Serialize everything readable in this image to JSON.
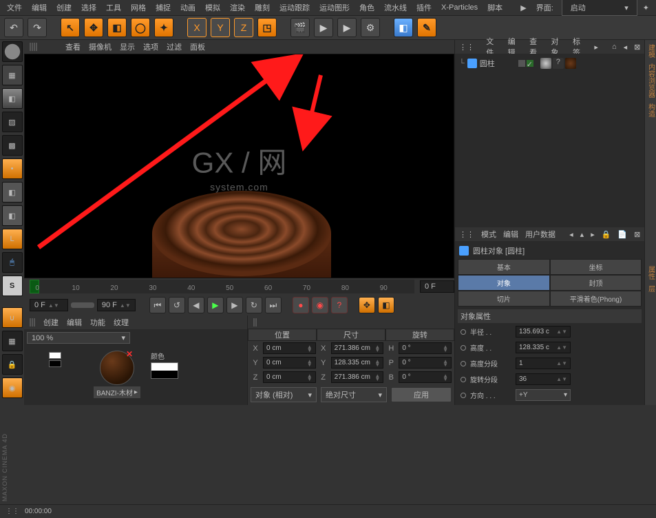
{
  "menubar": {
    "items": [
      "文件",
      "编辑",
      "创建",
      "选择",
      "工具",
      "网格",
      "捕捉",
      "动画",
      "模拟",
      "渲染",
      "雕刻",
      "运动跟踪",
      "运动图形",
      "角色",
      "流水线",
      "插件",
      "X-Particles",
      "脚本"
    ],
    "layout_label": "界面:",
    "layout_value": "启动"
  },
  "viewport_menu": [
    "查看",
    "摄像机",
    "显示",
    "选项",
    "过滤",
    "面板"
  ],
  "watermark": {
    "main": "GX / 网",
    "sub": "system.com"
  },
  "timeline": {
    "ticks": [
      "0",
      "10",
      "20",
      "30",
      "40",
      "50",
      "60",
      "70",
      "80",
      "90"
    ],
    "current": "0 F",
    "start": "0 F",
    "end": "90 F"
  },
  "material_panel": {
    "menu": [
      "创建",
      "编辑",
      "功能",
      "纹理"
    ],
    "slider": "100 %",
    "color_label": "颜色",
    "item1": "BANZI-木材"
  },
  "coord_panel": {
    "menu_icon": "⋮⋮⋮",
    "headers": [
      "位置",
      "尺寸",
      "旋转"
    ],
    "rows": [
      {
        "axis": "X",
        "pos": "0 cm",
        "sizelab": "X",
        "size": "271.386 cm",
        "rotlab": "H",
        "rot": "0 °"
      },
      {
        "axis": "Y",
        "pos": "0 cm",
        "sizelab": "Y",
        "size": "128.335 cm",
        "rotlab": "P",
        "rot": "0 °"
      },
      {
        "axis": "Z",
        "pos": "0 cm",
        "sizelab": "Z",
        "size": "271.386 cm",
        "rotlab": "B",
        "rot": "0 °"
      }
    ],
    "mode1": "对象 (相对)",
    "mode2": "绝对尺寸",
    "apply": "应用"
  },
  "object_panel": {
    "menu": [
      "文件",
      "编辑",
      "查看",
      "对象",
      "标签"
    ],
    "item": "圆柱"
  },
  "attr_panel": {
    "menu": [
      "模式",
      "编辑",
      "用户数据"
    ],
    "title": "圆柱对象 [圆柱]",
    "tabs": [
      "基本",
      "坐标",
      "对象",
      "封顶",
      "切片",
      "平滑着色(Phong)"
    ],
    "section": "对象属性",
    "props": [
      {
        "label": "半径 . .",
        "value": "135.693 c"
      },
      {
        "label": "高度 . .",
        "value": "128.335 c"
      },
      {
        "label": "高度分段",
        "value": "1"
      },
      {
        "label": "旋转分段",
        "value": "36"
      },
      {
        "label": "方向 . . .",
        "value": "+Y",
        "dropdown": true
      }
    ]
  },
  "far_right": [
    "建模",
    "内容浏览器",
    "构造"
  ],
  "far_right2": [
    "属性",
    "层"
  ],
  "status": {
    "time": "00:00:00"
  }
}
